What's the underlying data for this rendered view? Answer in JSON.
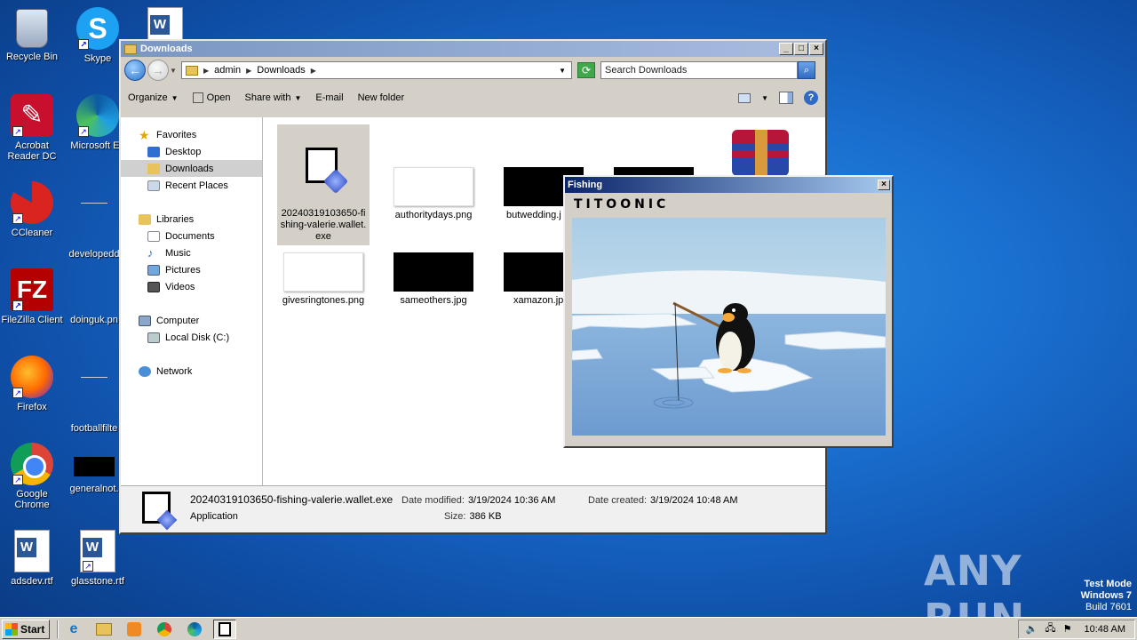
{
  "desktop": {
    "icons": [
      {
        "label": "Recycle Bin"
      },
      {
        "label": "Skype"
      },
      {
        "label": ""
      },
      {
        "label": "Acrobat Reader DC"
      },
      {
        "label": "Microsoft Ed"
      },
      {
        "label": "CCleaner"
      },
      {
        "label": "developedd"
      },
      {
        "label": "FileZilla Client"
      },
      {
        "label": "doinguk.pn"
      },
      {
        "label": "Firefox"
      },
      {
        "label": "footballfilte"
      },
      {
        "label": "Google Chrome"
      },
      {
        "label": "generalnot."
      },
      {
        "label": "adsdev.rtf"
      },
      {
        "label": "glasstone.rtf"
      }
    ]
  },
  "explorer": {
    "title": "Downloads",
    "address": {
      "crumbs": [
        "admin",
        "Downloads"
      ]
    },
    "search_placeholder": "Search Downloads",
    "toolbar": {
      "organize": "Organize",
      "open": "Open",
      "share_with": "Share with",
      "email": "E-mail",
      "new_folder": "New folder"
    },
    "nav": {
      "favorites": "Favorites",
      "desktop": "Desktop",
      "downloads": "Downloads",
      "recent": "Recent Places",
      "libraries": "Libraries",
      "documents": "Documents",
      "music": "Music",
      "pictures": "Pictures",
      "videos": "Videos",
      "computer": "Computer",
      "local_disk": "Local Disk (C:)",
      "network": "Network"
    },
    "files": [
      {
        "name": "20240319103650-fishing-valerie.wallet.exe"
      },
      {
        "name": "authoritydays.png"
      },
      {
        "name": "butwedding.j"
      },
      {
        "name": ""
      },
      {
        "name": ""
      },
      {
        "name": "givesringtones.png"
      },
      {
        "name": "sameothers.jpg"
      },
      {
        "name": "xamazon.jp"
      }
    ],
    "details": {
      "filename": "20240319103650-fishing-valerie.wallet.exe",
      "type": "Application",
      "modified_label": "Date modified:",
      "modified": "3/19/2024 10:36 AM",
      "size_label": "Size:",
      "size": "386 KB",
      "created_label": "Date created:",
      "created": "3/19/2024 10:48 AM"
    }
  },
  "fishing": {
    "title": "Fishing",
    "brand": "TITOONIC"
  },
  "taskbar": {
    "start": "Start",
    "clock": "10:48 AM"
  },
  "watermark": {
    "line1": "Test Mode",
    "line2": "Windows 7",
    "line3": "Build 7601",
    "anyrun": "ANY RUN"
  },
  "colors": {
    "desktop_bg": "#1a6fcf",
    "fishing_title": "#0a246a",
    "water": "#7aa8d8",
    "ice": "#eef4f8"
  }
}
